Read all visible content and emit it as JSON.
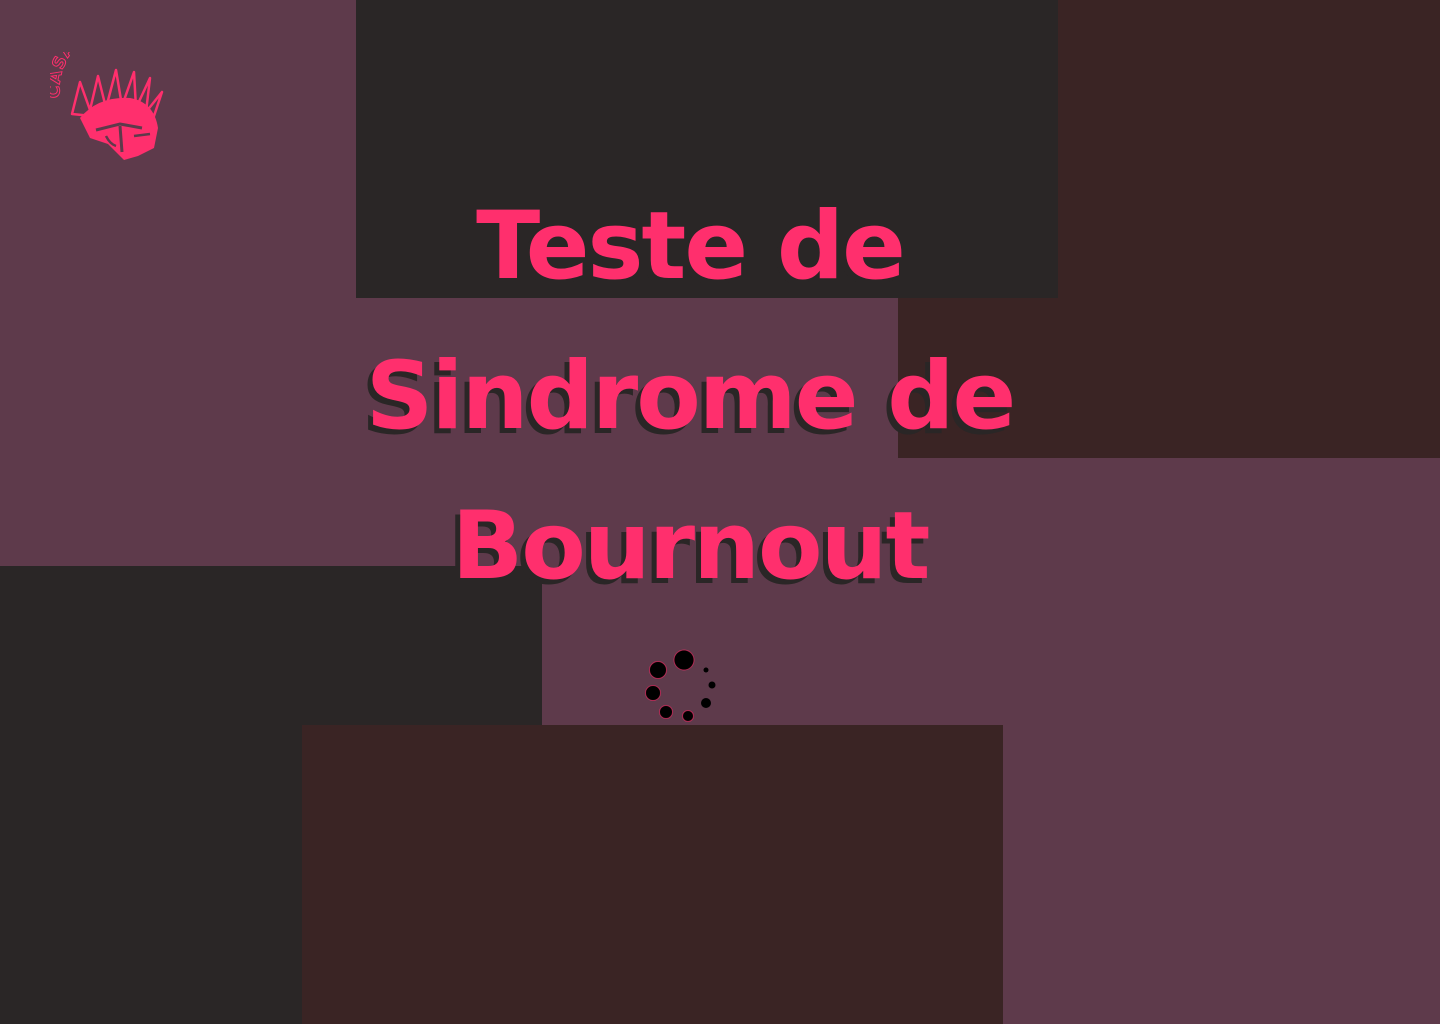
{
  "logo": {
    "text": "CASART T.I",
    "icon": "spartan-helmet-icon",
    "color": "#ff2f6d"
  },
  "title": {
    "lines": [
      "Teste de",
      "Sindrome de",
      "Bournout"
    ]
  },
  "loader": {
    "icon": "loading-spinner-icon"
  },
  "colors": {
    "accent": "#ff2f6d",
    "background": "#5e3a4b",
    "dark": "#2a2626",
    "brown": "#3a2424"
  }
}
